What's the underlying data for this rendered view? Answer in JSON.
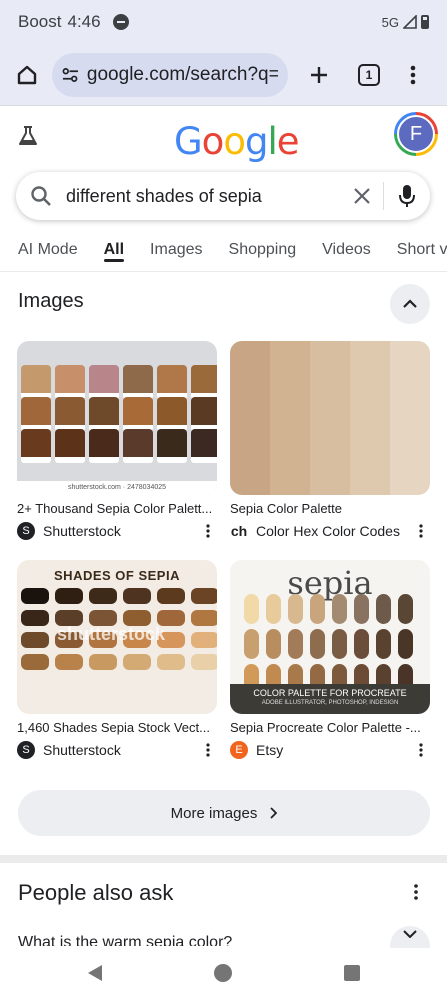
{
  "status_bar": {
    "carrier": "Boost",
    "time": "4:46",
    "network": "5G"
  },
  "browser": {
    "url": "google.com/search?q=d",
    "tab_count": "1"
  },
  "google": {
    "logo_text": "Google",
    "avatar_initial": "F"
  },
  "search": {
    "query": "different shades of sepia"
  },
  "tabs": [
    {
      "label": "AI Mode"
    },
    {
      "label": "All"
    },
    {
      "label": "Images"
    },
    {
      "label": "Shopping"
    },
    {
      "label": "Videos"
    },
    {
      "label": "Short vi"
    }
  ],
  "images_section": {
    "heading": "Images",
    "results": [
      {
        "caption": "2+ Thousand Sepia Color Palett...",
        "source": "Shutterstock",
        "source_icon": "shutterstock-icon",
        "watermark": "shutterstock.com · 2478034025"
      },
      {
        "caption": "Sepia Color Palette",
        "source": "Color Hex Color Codes",
        "source_icon": "colorhex-icon"
      },
      {
        "caption": "1,460 Shades Sepia Stock Vect...",
        "source": "Shutterstock",
        "source_icon": "shutterstock-icon",
        "image_title": "SHADES OF SEPIA",
        "image_watermark": "shutterstock"
      },
      {
        "caption": "Sepia Procreate Color Palette -...",
        "source": "Etsy",
        "source_icon": "etsy-icon",
        "image_title": "sepia",
        "banner_line1": "COLOR PALETTE FOR PROCREATE",
        "banner_line2": "ADOBE ILLUSTRATOR, PHOTOSHOP, INDESIGN"
      }
    ],
    "more_button": "More images"
  },
  "people_also_ask": {
    "heading": "People also ask",
    "first_question": "What is the warm sepia color?"
  },
  "colors": {
    "browser_chrome": "#e8eaf6",
    "active_tab": "#202124",
    "shutterstock": "#202124",
    "etsy": "#f1641e"
  }
}
